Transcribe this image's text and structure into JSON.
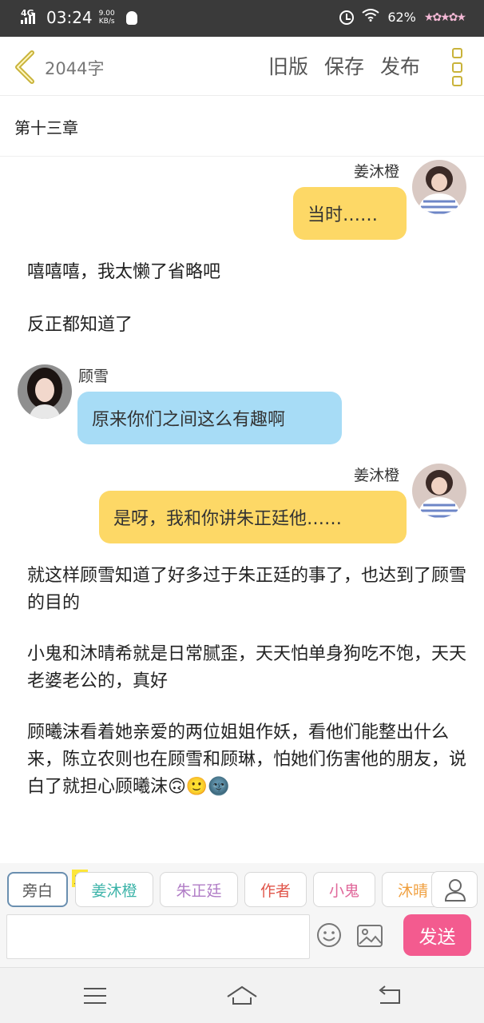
{
  "status_bar": {
    "network": "4G",
    "time": "03:24",
    "speed_value": "9.00",
    "speed_unit": "KB/s",
    "battery": "62%"
  },
  "header": {
    "word_count": "2044字",
    "old_version_label": "旧版",
    "save_label": "保存",
    "publish_label": "发布",
    "accent_color": "#c9b33a"
  },
  "chapter_title": "第十三章",
  "messages": [
    {
      "speaker": "姜沐橙",
      "text": "当时……"
    },
    {
      "narration": "嘻嘻嘻，我太懒了省略吧"
    },
    {
      "narration": "反正都知道了"
    },
    {
      "speaker": "顾雪",
      "text": "原来你们之间这么有趣啊"
    },
    {
      "speaker": "姜沐橙",
      "text": "是呀，我和你讲朱正廷他……"
    },
    {
      "narration": "就这样顾雪知道了好多过于朱正廷的事了，也达到了顾雪的目的"
    },
    {
      "narration": "小鬼和沐晴希就是日常腻歪，天天怕单身狗吃不饱，天天老婆老公的，真好"
    },
    {
      "narration": "顾曦沫看着她亲爱的两位姐姐作妖，看他们能整出什么来，陈立农则也在顾雪和顾琳，怕她们伤害他的朋友，说白了就担心顾曦沫🙃🙂🌚"
    }
  ],
  "roles": [
    {
      "label": "旁白",
      "color": "#555555"
    },
    {
      "label": "姜沐橙",
      "color": "#3bb3a8"
    },
    {
      "label": "朱正廷",
      "color": "#b07cc6"
    },
    {
      "label": "作者",
      "color": "#e0554a"
    },
    {
      "label": "小鬼",
      "color": "#e0679a"
    },
    {
      "label": "沐晴",
      "color": "#f0a040"
    }
  ],
  "host_badge": "主",
  "send_label": "发送",
  "colors": {
    "bubble_yellow": "#fdd866",
    "bubble_blue": "#a7dcf6",
    "send_button": "#f35b8f"
  },
  "icons": [
    "back-arrow-icon",
    "menu-dots-icon",
    "person-icon",
    "emoji-icon",
    "image-icon",
    "menu-icon",
    "home-icon",
    "return-icon"
  ]
}
